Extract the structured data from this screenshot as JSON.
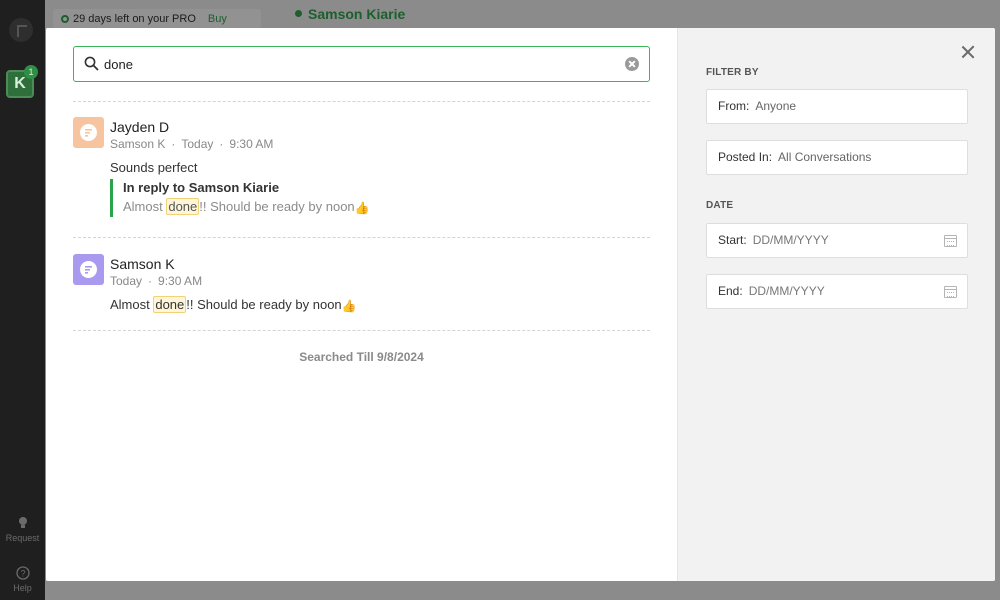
{
  "background": {
    "workspace_initial": "K",
    "workspace_badge": "1",
    "pro_banner": "29 days left on your PRO",
    "pro_buy": "Buy",
    "chat_title": "Samson Kiarie",
    "rail_request": "Request",
    "rail_help": "Help"
  },
  "search": {
    "value": "done",
    "placeholder": ""
  },
  "results": [
    {
      "name": "Jayden D",
      "meta_author": "Samson K",
      "meta_day": "Today",
      "meta_time": "9:30 AM",
      "text": "Sounds perfect",
      "reply_title": "In reply to Samson Kiarie",
      "reply_before": "Almost ",
      "reply_match": "done",
      "reply_after": "!! Should be ready by noon",
      "avatar_color": "#f7c4a0"
    },
    {
      "name": "Samson K",
      "meta_day": "Today",
      "meta_time": "9:30 AM",
      "text_before": "Almost ",
      "text_match": "done",
      "text_after": "!! Should be ready by noon",
      "avatar_color": "#a99af0"
    }
  ],
  "searched_till": "Searched Till 9/8/2024",
  "filter": {
    "title": "FILTER BY",
    "from_label": "From:",
    "from_value": "Anyone",
    "posted_label": "Posted In:",
    "posted_value": "All Conversations"
  },
  "date": {
    "title": "DATE",
    "start_label": "Start:",
    "start_placeholder": "DD/MM/YYYY",
    "end_label": "End:",
    "end_placeholder": "DD/MM/YYYY"
  },
  "colors": {
    "accent": "#3cb55a",
    "highlight_bg": "#fff6d9",
    "highlight_border": "#f1d27a"
  }
}
